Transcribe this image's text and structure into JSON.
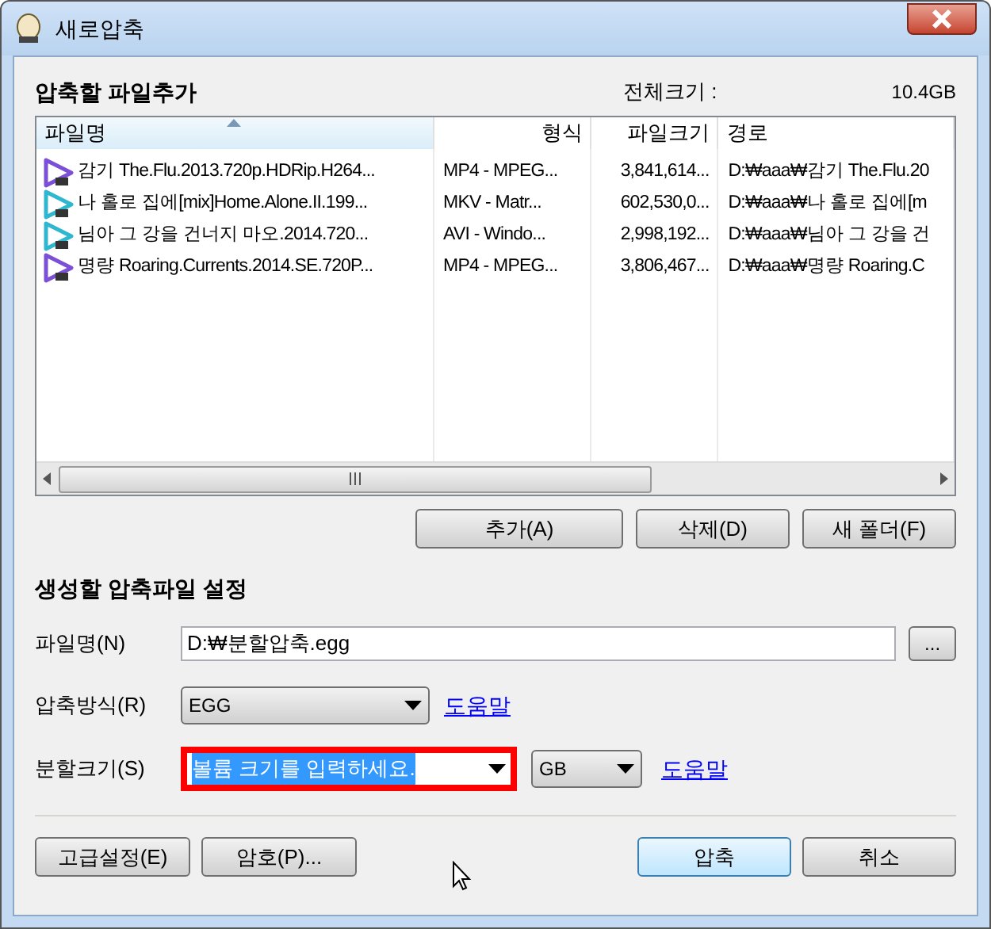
{
  "window": {
    "title": "새로압축"
  },
  "file_section": {
    "title": "압축할 파일추가",
    "total_label": "전체크기 :",
    "total_value": "10.4GB"
  },
  "file_list": {
    "columns": [
      {
        "label": "파일명",
        "sorted": true
      },
      {
        "label": "형식",
        "sorted": false
      },
      {
        "label": "파일크기",
        "sorted": false
      },
      {
        "label": "경로",
        "sorted": false
      }
    ],
    "rows": [
      {
        "color": "#7b4fd6",
        "cells": [
          "감기 The.Flu.2013.720p.HDRip.H264...",
          "MP4 - MPEG...",
          "3,841,614...",
          "D:₩aaa₩감기 The.Flu.20"
        ]
      },
      {
        "color": "#2fb7d0",
        "cells": [
          "나 홀로 집에[mix]Home.Alone.II.199...",
          "MKV - Matr...",
          "602,530,0...",
          "D:₩aaa₩나 홀로 집에[m"
        ]
      },
      {
        "color": "#2fb7d0",
        "cells": [
          "님아 그 강을 건너지 마오.2014.720...",
          "AVI - Windo...",
          "2,998,192...",
          "D:₩aaa₩님아 그 강을 건"
        ]
      },
      {
        "color": "#7b4fd6",
        "cells": [
          "명량 Roaring.Currents.2014.SE.720P...",
          "MP4 - MPEG...",
          "3,806,467...",
          "D:₩aaa₩명량 Roaring.C"
        ]
      }
    ]
  },
  "list_buttons": [
    {
      "label": "추가(A)"
    },
    {
      "label": "삭제(D)"
    },
    {
      "label": "새 폴더(F)"
    }
  ],
  "settings": {
    "title": "생성할 압축파일 설정",
    "filename": {
      "label": "파일명(N)",
      "value": "D:₩분할압축.egg",
      "browse": "..."
    },
    "method": {
      "label": "압축방식(R)",
      "value": "EGG",
      "help": "도움말"
    },
    "split": {
      "label": "분할크기(S)",
      "value": "볼륨 크기를 입력하세요.",
      "highlighted": true,
      "text_selected": true,
      "unit": "GB",
      "help": "도움말"
    }
  },
  "bottom_buttons": [
    {
      "label": "고급설정(E)",
      "default": false
    },
    {
      "label": "암호(P)...",
      "default": false
    },
    {
      "label": "압축",
      "default": true
    },
    {
      "label": "취소",
      "default": false
    }
  ]
}
